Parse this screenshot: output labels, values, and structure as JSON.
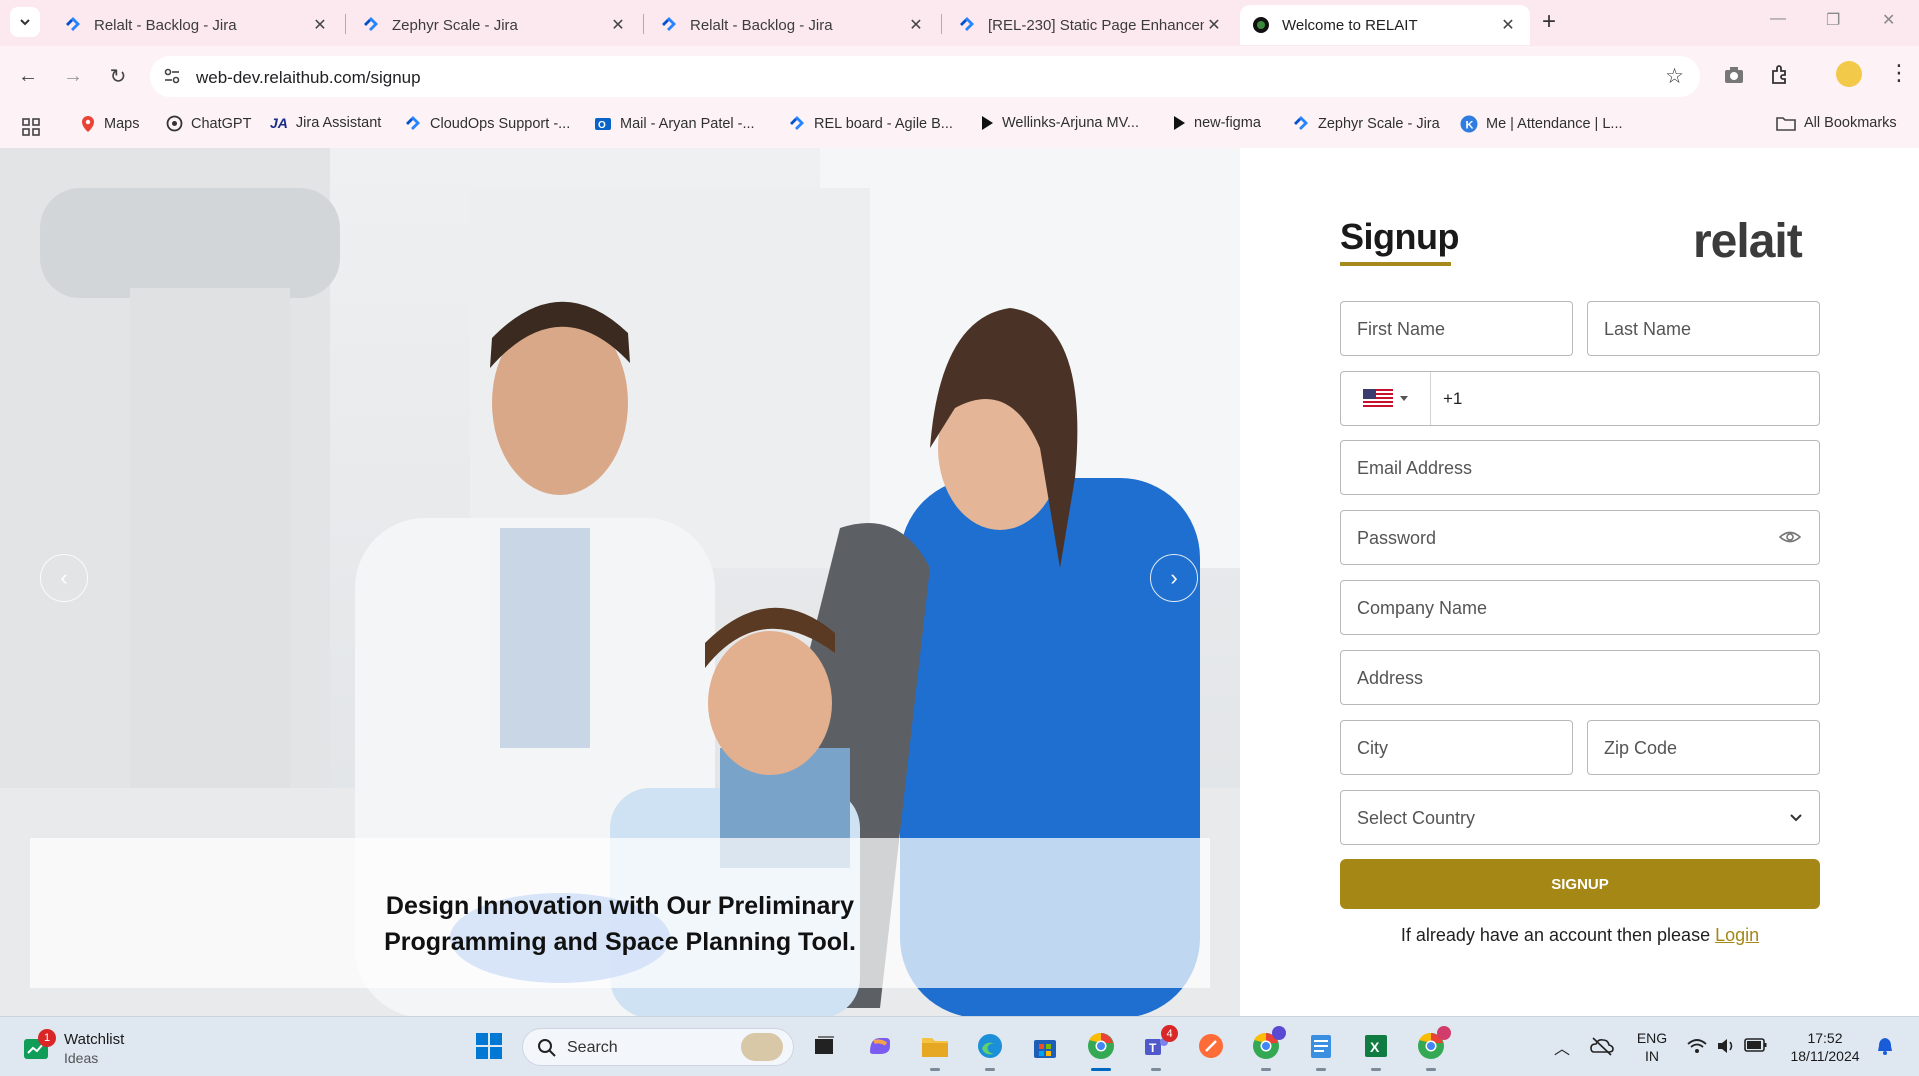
{
  "browser": {
    "tabs": [
      {
        "title": "Relalt - Backlog - Jira",
        "icon": "jira-icon",
        "active": false
      },
      {
        "title": "Zephyr Scale - Jira",
        "icon": "jira-icon",
        "active": false
      },
      {
        "title": "Relalt - Backlog - Jira",
        "icon": "jira-icon",
        "active": false
      },
      {
        "title": "[REL-230] Static Page Enhancem",
        "icon": "jira-icon",
        "active": false
      },
      {
        "title": "Welcome to RELAIT",
        "icon": "relait-favicon",
        "active": true
      }
    ],
    "new_tab_label": "+",
    "url": "web-dev.relaithub.com/signup",
    "bookmarks": [
      {
        "label": "Maps",
        "icon": "maps-icon"
      },
      {
        "label": "ChatGPT",
        "icon": "chatgpt-icon"
      },
      {
        "label": "Jira Assistant",
        "icon": "jira-assistant-icon"
      },
      {
        "label": "CloudOps Support -...",
        "icon": "jira-icon"
      },
      {
        "label": "Mail - Aryan Patel -...",
        "icon": "outlook-icon"
      },
      {
        "label": "REL board - Agile B...",
        "icon": "jira-icon"
      },
      {
        "label": "Wellinks-Arjuna MV...",
        "icon": "play-icon"
      },
      {
        "label": "new-figma",
        "icon": "play-icon"
      },
      {
        "label": "Zephyr Scale - Jira",
        "icon": "jira-icon"
      },
      {
        "label": "Me | Attendance | L...",
        "icon": "k-icon"
      }
    ],
    "all_bookmarks_label": "All Bookmarks"
  },
  "hero": {
    "caption_line1": "Design Innovation with Our Preliminary",
    "caption_line2": "Programming and Space Planning Tool."
  },
  "signup": {
    "title": "Signup",
    "logo_text": "relait",
    "first_name_placeholder": "First Name",
    "last_name_placeholder": "Last Name",
    "phone_country_code": "+1",
    "email_placeholder": "Email Address",
    "password_placeholder": "Password",
    "company_placeholder": "Company Name",
    "address_placeholder": "Address",
    "city_placeholder": "City",
    "zip_placeholder": "Zip Code",
    "country_placeholder": "Select Country",
    "submit_label": "SIGNUP",
    "login_prompt": "If already have an account then please",
    "login_link": "Login",
    "accent_color": "#a58716"
  },
  "taskbar": {
    "watchlist_title": "Watchlist",
    "watchlist_sub": "Ideas",
    "watchlist_badge": "1",
    "search_label": "Search",
    "teams_badge": "4",
    "lang_top": "ENG",
    "lang_bottom": "IN",
    "time": "17:52",
    "date": "18/11/2024"
  }
}
